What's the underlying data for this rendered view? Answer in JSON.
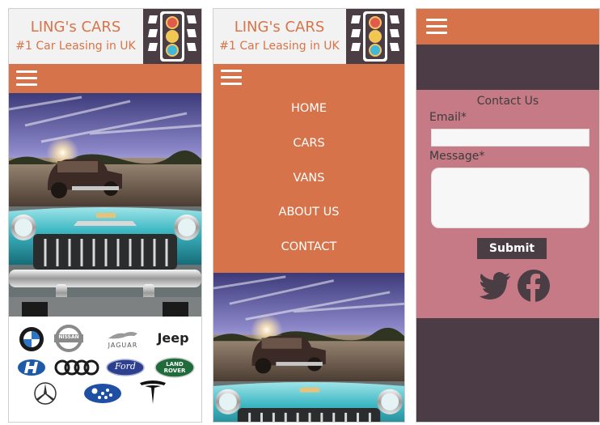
{
  "brand": {
    "name": "LING's CARS",
    "tagline": "#1 Car Leasing in UK"
  },
  "menu": {
    "items": [
      "HOME",
      "CARS",
      "VANS",
      "ABOUT US",
      "CONTACT"
    ]
  },
  "logos": {
    "jaguar": "JAGUAR",
    "jeep": "Jeep",
    "ford": "Ford",
    "landrover_line1": "LAND",
    "landrover_line2": "ROVER",
    "nissan": "NISSAN"
  },
  "contact": {
    "title": "Contact Us",
    "email_label": "Email*",
    "email_value": "",
    "message_label": "Message*",
    "message_value": "",
    "submit_label": "Submit"
  },
  "icons": [
    "hamburger-menu-icon",
    "traffic-light-icon",
    "twitter-icon",
    "facebook-icon"
  ],
  "colors": {
    "accent_orange": "#d7734a",
    "brand_text": "#d97448",
    "dark_plum": "#4c3c45",
    "form_pink": "#c57a86"
  }
}
